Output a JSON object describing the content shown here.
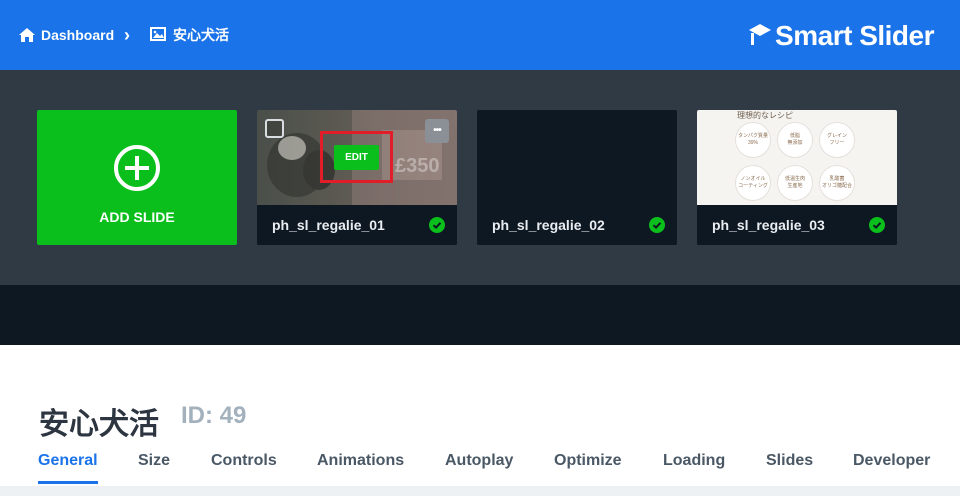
{
  "breadcrumb": {
    "home_label": "Dashboard",
    "separator": "›",
    "current_label": "安心犬活"
  },
  "brand": {
    "text": "Smart Slider",
    "accent": "#1a73e8"
  },
  "add_slide": {
    "label": "ADD SLIDE",
    "color": "#0abf1c"
  },
  "slides": [
    {
      "name": "ph_sl_regalie_01",
      "edit_label": "EDIT",
      "more_label": "•••",
      "published": true,
      "overlay_text": "£350"
    },
    {
      "name": "ph_sl_regalie_02",
      "published": true
    },
    {
      "name": "ph_sl_regalie_03",
      "published": true,
      "thumb_title": "理想的なレシピ",
      "thumb_items": [
        "タンパク質量\n39%",
        "低脂\n無添加",
        "グレイン\nフリー",
        "ノンオイル\nコーティング",
        "低温生肉\n生産地",
        "乳酸菌\nオリゴ糖配合"
      ]
    }
  ],
  "slider": {
    "title": "安心犬活",
    "id_label": "ID: 49"
  },
  "tabs": [
    "General",
    "Size",
    "Controls",
    "Animations",
    "Autoplay",
    "Optimize",
    "Loading",
    "Slides",
    "Developer"
  ],
  "active_tab": "General",
  "colors": {
    "topbar": "#1a73e8",
    "slides_bg": "#2f3a45",
    "dark": "#0e1822",
    "check": "#0abf1c",
    "highlight": "#e11d2a"
  }
}
